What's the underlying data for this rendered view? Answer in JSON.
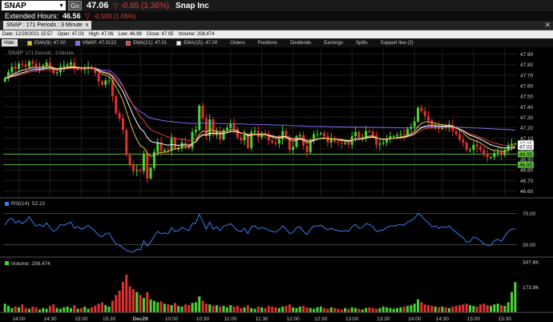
{
  "header": {
    "symbol": "SNAP",
    "go_label": "Go",
    "price": "47.06",
    "change": "-0.65 (1.36%)",
    "company": "Snap Inc",
    "extended_label": "Extended Hours:",
    "extended_price": "46.56",
    "extended_change": "-0.500 (1.06%)"
  },
  "tab": {
    "label": "SNAP : 171  Periods : 3 Minute",
    "close": "x"
  },
  "info": {
    "date": "Date: 12/29/2021 15:57",
    "open": "Open: 47.03",
    "high": "High: 47.06",
    "low": "Low: 46.98",
    "close": "Close: 47.05",
    "volume": "Volume: 208,474"
  },
  "studies": {
    "hide_label": "Hide:",
    "items": [
      {
        "label": "EMA(9): 47.00",
        "color": "#e0c040"
      },
      {
        "label": "VWAP: 47.0122",
        "color": "#7c6cf0"
      },
      {
        "label": "EMA(21): 47.01",
        "color": "#e04040"
      },
      {
        "label": "EMA(15): 47.00",
        "color": "#ffffff"
      }
    ],
    "menu": [
      "Orders",
      "Positions",
      "Dividends",
      "Earnings",
      "Splits",
      "Support line (2)"
    ]
  },
  "chart_data": {
    "type": "line",
    "title": "SNAP",
    "subtitle": "171  Periods : 3 Minute",
    "price_axis": [
      "47.90",
      "47.80",
      "47.70",
      "47.60",
      "47.50",
      "47.40",
      "47.30",
      "47.20",
      "47.10",
      "47.00",
      "46.90",
      "46.80",
      "46.70",
      "46.60"
    ],
    "price_ylim": [
      46.55,
      47.95
    ],
    "support_lines": [
      46.95,
      46.85
    ],
    "price_tags": [
      "47.05",
      "47.02",
      "46.95",
      "46.85"
    ],
    "x_ticks": [
      "14:00",
      "14:30",
      "15:00",
      "15:30",
      "Dec29",
      "10:00",
      "10:30",
      "11:00",
      "11:30",
      "12:00",
      "12:30",
      "13:00",
      "13:30",
      "14:00",
      "14:30",
      "15:00",
      "15:30"
    ],
    "rsi_label": "RSI(14): 52.22",
    "rsi_axis": [
      "70.00",
      "30.00"
    ],
    "volume_label": "Volume: 208,474",
    "volume_axis": [
      "347.8K",
      "173.9K"
    ],
    "close": [
      47.67,
      47.73,
      47.78,
      47.76,
      47.81,
      47.8,
      47.78,
      47.83,
      47.81,
      47.77,
      47.77,
      47.79,
      47.82,
      47.77,
      47.72,
      47.73,
      47.78,
      47.79,
      47.8,
      47.82,
      47.76,
      47.76,
      47.75,
      47.76,
      47.78,
      47.76,
      47.72,
      47.64,
      47.61,
      47.65,
      47.65,
      47.5,
      47.34,
      47.29,
      47.18,
      46.94,
      46.85,
      46.79,
      46.8,
      46.79,
      46.95,
      46.72,
      46.82,
      46.97,
      47.06,
      46.98,
      46.99,
      46.98,
      47.1,
      47.0,
      47.01,
      47.06,
      47.04,
      47.01,
      47.16,
      47.18,
      47.41,
      47.29,
      47.12,
      47.28,
      47.13,
      47.17,
      47.09,
      47.18,
      47.2,
      47.24,
      47.19,
      47.11,
      47.08,
      47.14,
      47.01,
      47.16,
      47.17,
      47.11,
      47.15,
      47.13,
      47.08,
      47.06,
      47.05,
      47.09,
      47.17,
      47.1,
      46.99,
      47.02,
      47.12,
      47.13,
      47.03,
      46.97,
      47.08,
      47.14,
      47.14,
      47.15,
      47.12,
      47.06,
      47.1,
      47.07,
      47.06,
      47.05,
      47.06,
      47.04,
      47.12,
      47.16,
      47.1,
      47.11,
      47.17,
      47.16,
      47.13,
      47.04,
      47.05,
      47.06,
      47.1,
      47.12,
      47.12,
      47.13,
      47.14,
      47.13,
      47.19,
      47.21,
      47.26,
      47.39,
      47.36,
      47.31,
      47.27,
      47.21,
      47.22,
      47.19,
      47.22,
      47.2,
      47.23,
      47.17,
      47.14,
      47.09,
      47.06,
      46.99,
      46.99,
      47.04,
      47.02,
      46.99,
      46.95,
      46.92,
      46.92,
      46.96,
      46.97,
      46.94,
      46.99,
      47.03,
      47.05,
      47.05
    ],
    "rsi": [
      55,
      62,
      64,
      58,
      61,
      57,
      60,
      66,
      59,
      54,
      56,
      53,
      58,
      52,
      47,
      50,
      56,
      55,
      57,
      59,
      51,
      53,
      50,
      52,
      55,
      51,
      47,
      42,
      40,
      44,
      45,
      37,
      31,
      29,
      26,
      22,
      21,
      20,
      24,
      23,
      35,
      28,
      33,
      41,
      47,
      44,
      45,
      44,
      52,
      47,
      48,
      52,
      50,
      48,
      57,
      58,
      69,
      60,
      50,
      59,
      50,
      53,
      48,
      54,
      55,
      57,
      53,
      48,
      47,
      51,
      44,
      53,
      54,
      50,
      52,
      51,
      48,
      47,
      46,
      49,
      54,
      50,
      44,
      46,
      52,
      53,
      47,
      43,
      50,
      54,
      54,
      55,
      52,
      49,
      51,
      49,
      48,
      47,
      48,
      47,
      53,
      56,
      51,
      52,
      57,
      56,
      53,
      47,
      48,
      49,
      52,
      54,
      54,
      55,
      56,
      55,
      59,
      61,
      64,
      70,
      67,
      62,
      58,
      53,
      54,
      51,
      53,
      52,
      54,
      49,
      46,
      42,
      39,
      33,
      34,
      40,
      38,
      35,
      31,
      29,
      29,
      35,
      37,
      34,
      41,
      47,
      50,
      50
    ],
    "volume": [
      60,
      45,
      30,
      40,
      35,
      55,
      30,
      25,
      40,
      35,
      20,
      30,
      25,
      45,
      55,
      30,
      25,
      35,
      40,
      30,
      50,
      25,
      30,
      40,
      25,
      35,
      45,
      60,
      70,
      50,
      40,
      80,
      120,
      150,
      210,
      260,
      180,
      160,
      140,
      120,
      100,
      140,
      90,
      80,
      70,
      75,
      60,
      55,
      50,
      65,
      45,
      40,
      55,
      50,
      65,
      70,
      110,
      80,
      60,
      55,
      45,
      50,
      40,
      45,
      35,
      50,
      40,
      45,
      30,
      35,
      50,
      30,
      25,
      40,
      35,
      30,
      45,
      40,
      35,
      30,
      40,
      45,
      55,
      35,
      30,
      40,
      45,
      35,
      30,
      25,
      35,
      40,
      30,
      25,
      35,
      30,
      25,
      20,
      30,
      25,
      35,
      30,
      25,
      20,
      30,
      35,
      30,
      25,
      30,
      40,
      35,
      30,
      25,
      30,
      35,
      40,
      45,
      50,
      60,
      90,
      70,
      55,
      50,
      45,
      40,
      35,
      40,
      35,
      30,
      40,
      45,
      50,
      55,
      60,
      50,
      45,
      40,
      55,
      60,
      50,
      45,
      55,
      60,
      50,
      45,
      70,
      140,
      208
    ]
  }
}
